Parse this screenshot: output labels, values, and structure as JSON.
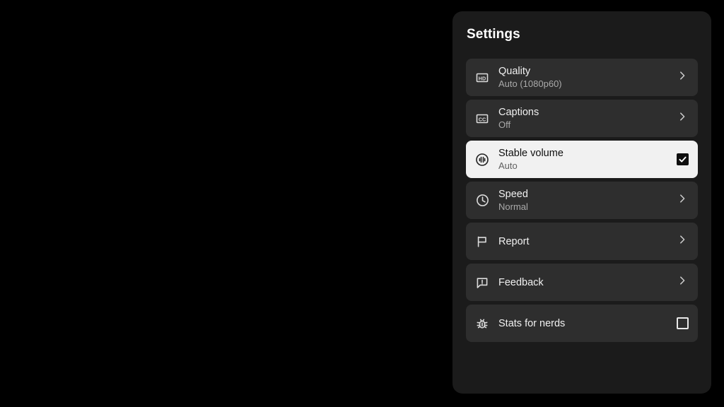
{
  "panel": {
    "title": "Settings",
    "background_color": "#1b1b1b",
    "row_color": "#2e2e2e",
    "highlight_color": "#f1f1f1",
    "page_background": "#000000"
  },
  "menu": {
    "items": [
      {
        "id": "quality",
        "icon": "hd-icon",
        "label": "Quality",
        "value": "Auto (1080p60)",
        "trailing": "chevron-right-icon",
        "highlighted": false
      },
      {
        "id": "captions",
        "icon": "cc-icon",
        "label": "Captions",
        "value": "Off",
        "trailing": "chevron-right-icon",
        "highlighted": false
      },
      {
        "id": "stable-volume",
        "icon": "stable-volume-icon",
        "label": "Stable volume",
        "value": "Auto",
        "trailing": "checkbox-checked",
        "highlighted": true
      },
      {
        "id": "speed",
        "icon": "clock-icon",
        "label": "Speed",
        "value": "Normal",
        "trailing": "chevron-right-icon",
        "highlighted": false
      },
      {
        "id": "report",
        "icon": "flag-icon",
        "label": "Report",
        "value": "",
        "trailing": "chevron-right-icon",
        "highlighted": false
      },
      {
        "id": "feedback",
        "icon": "feedback-icon",
        "label": "Feedback",
        "value": "",
        "trailing": "chevron-right-icon",
        "highlighted": false
      },
      {
        "id": "stats-for-nerds",
        "icon": "bug-icon",
        "label": "Stats for nerds",
        "value": "",
        "trailing": "checkbox-unchecked",
        "highlighted": false
      }
    ]
  }
}
